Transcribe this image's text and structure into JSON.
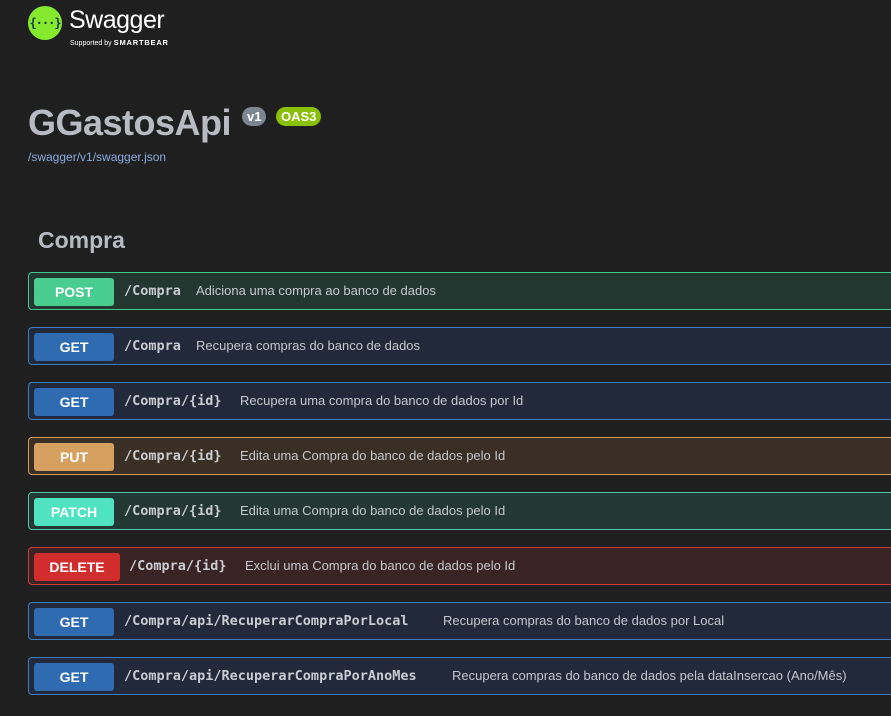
{
  "topbar": {
    "logo_icon_text": "{···}",
    "logo_name": "Swagger",
    "logo_tm": "™",
    "supported_by": "Supported by",
    "brand": "SMARTBEAR"
  },
  "info": {
    "title": "GGastosApi",
    "version": "v1",
    "oas": "OAS3",
    "spec_url": "/swagger/v1/swagger.json"
  },
  "tag": {
    "name": "Compra"
  },
  "operations": [
    {
      "method": "POST",
      "path": "/Compra",
      "summary": "Adiciona uma compra ao banco de dados"
    },
    {
      "method": "GET",
      "path": "/Compra",
      "summary": "Recupera compras do banco de dados"
    },
    {
      "method": "GET",
      "path": "/Compra/{id}",
      "summary": "Recupera uma compra do banco de dados por Id"
    },
    {
      "method": "PUT",
      "path": "/Compra/{id}",
      "summary": "Edita uma Compra do banco de dados pelo Id"
    },
    {
      "method": "PATCH",
      "path": "/Compra/{id}",
      "summary": "Edita uma Compra do banco de dados pelo Id"
    },
    {
      "method": "DELETE",
      "path": "/Compra/{id}",
      "summary": "Exclui uma Compra do banco de dados pelo Id"
    },
    {
      "method": "GET",
      "path": "/Compra/api/RecuperarCompraPorLocal",
      "summary": "Recupera compras do banco de dados por Local"
    },
    {
      "method": "GET",
      "path": "/Compra/api/RecuperarCompraPorAnoMes",
      "summary": "Recupera compras do banco de dados pela dataInsercao (Ano/Mês)"
    }
  ],
  "colors": {
    "post": "#49cc90",
    "get": "#2f6bb0",
    "put": "#d6a060",
    "patch": "#50e3c2",
    "delete": "#d22d2d",
    "logo": "#85ea2d"
  }
}
